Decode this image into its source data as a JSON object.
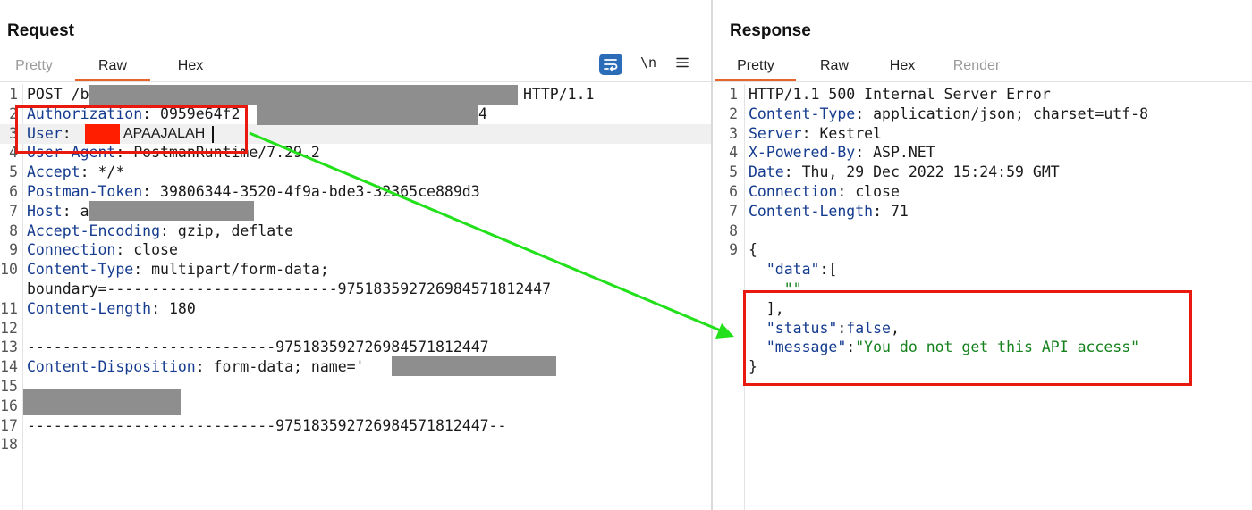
{
  "request": {
    "title": "Request",
    "tabs": [
      {
        "label": "Pretty",
        "state": "muted"
      },
      {
        "label": "Raw",
        "state": "active"
      },
      {
        "label": "Hex",
        "state": "normal"
      }
    ],
    "toolbar": {
      "wrap_icon": "wrap-lines-icon",
      "newline_label": "\\n",
      "menu_icon": "menu-icon"
    },
    "lines": [
      {
        "n": "1",
        "k": "",
        "v": "POST /b"
      },
      {
        "n": "2",
        "k": "Authorization",
        "v": ": 0959e64f2"
      },
      {
        "n": "3",
        "k": "User",
        "v": ":"
      },
      {
        "n": "4",
        "k": "User-Agent",
        "v": ": PostmanRuntime/7.29.2"
      },
      {
        "n": "5",
        "k": "Accept",
        "v": ": */*"
      },
      {
        "n": "6",
        "k": "Postman-Token",
        "v": ": 39806344-3520-4f9a-bde3-32365ce889d3"
      },
      {
        "n": "7",
        "k": "Host",
        "v": ": a"
      },
      {
        "n": "8",
        "k": "Accept-Encoding",
        "v": ": gzip, deflate"
      },
      {
        "n": "9",
        "k": "Connection",
        "v": ": close"
      },
      {
        "n": "10",
        "k": "Content-Type",
        "v": ": multipart/form-data;"
      },
      {
        "n": "",
        "k": "",
        "v": "boundary=--------------------------975183592726984571812447"
      },
      {
        "n": "11",
        "k": "Content-Length",
        "v": ": 180"
      },
      {
        "n": "12",
        "k": "",
        "v": ""
      },
      {
        "n": "13",
        "k": "",
        "v": "----------------------------975183592726984571812447"
      },
      {
        "n": "14",
        "k": "Content-Disposition",
        "v": ": form-data; name='"
      },
      {
        "n": "15",
        "k": "",
        "v": ""
      },
      {
        "n": "16",
        "k": "",
        "v": ""
      },
      {
        "n": "17",
        "k": "",
        "v": "----------------------------975183592726984571812447--"
      },
      {
        "n": "18",
        "k": "",
        "v": ""
      }
    ],
    "line1_suffix": "HTTP/1.1",
    "auth_suffix": "4",
    "user_value": "APAAJALAH"
  },
  "response": {
    "title": "Response",
    "tabs": [
      {
        "label": "Pretty",
        "state": "active"
      },
      {
        "label": "Raw",
        "state": "normal"
      },
      {
        "label": "Hex",
        "state": "normal"
      },
      {
        "label": "Render",
        "state": "muted"
      }
    ],
    "lines": [
      {
        "n": "1",
        "k": "",
        "v": "HTTP/1.1 500 Internal Server Error"
      },
      {
        "n": "2",
        "k": "Content-Type",
        "v": ": application/json; charset=utf-8"
      },
      {
        "n": "3",
        "k": "Server",
        "v": ": Kestrel"
      },
      {
        "n": "4",
        "k": "X-Powered-By",
        "v": ": ASP.NET"
      },
      {
        "n": "5",
        "k": "Date",
        "v": ": Thu, 29 Dec 2022 15:24:59 GMT"
      },
      {
        "n": "6",
        "k": "Connection",
        "v": ": close"
      },
      {
        "n": "7",
        "k": "Content-Length",
        "v": ": 71"
      },
      {
        "n": "8",
        "k": "",
        "v": ""
      },
      {
        "n": "9",
        "k": "",
        "v": "{"
      }
    ],
    "json_lines": [
      {
        "parts": [
          {
            "t": "  ",
            "c": "val"
          },
          {
            "t": "\"data\"",
            "c": "key"
          },
          {
            "t": ":[",
            "c": "val"
          }
        ]
      },
      {
        "parts": [
          {
            "t": "    ",
            "c": "val"
          },
          {
            "t": "\"\"",
            "c": "str"
          }
        ]
      },
      {
        "parts": [
          {
            "t": "  ],",
            "c": "val"
          }
        ]
      },
      {
        "parts": [
          {
            "t": "  ",
            "c": "val"
          },
          {
            "t": "\"status\"",
            "c": "key"
          },
          {
            "t": ":",
            "c": "val"
          },
          {
            "t": "false",
            "c": "key"
          },
          {
            "t": ",",
            "c": "val"
          }
        ]
      },
      {
        "parts": [
          {
            "t": "  ",
            "c": "val"
          },
          {
            "t": "\"message\"",
            "c": "key"
          },
          {
            "t": ":",
            "c": "val"
          },
          {
            "t": "\"You do not get this API access\"",
            "c": "str"
          }
        ]
      },
      {
        "parts": [
          {
            "t": "}",
            "c": "val"
          }
        ]
      }
    ]
  },
  "colors": {
    "tab_underline": "#e8642a",
    "header_key": "#143b8f",
    "string": "#16821e",
    "annotation_red": "#e8190f",
    "arrow_green": "#22e01a",
    "wrap_button": "#2b6cb8"
  }
}
